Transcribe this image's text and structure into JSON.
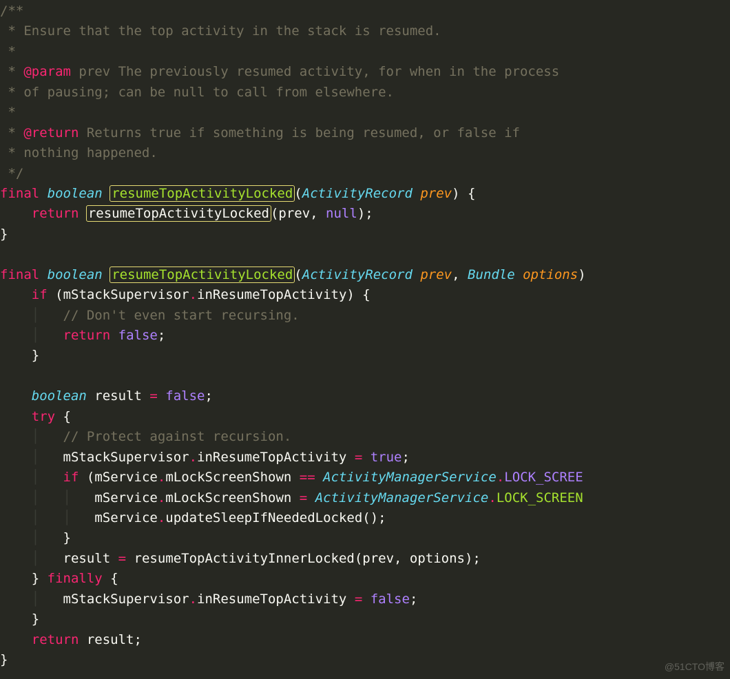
{
  "doc": {
    "start": "/**",
    "l1": " * Ensure that the top activity in the stack is resumed.",
    "l2": " *",
    "l3_a": " * ",
    "l3_tag": "@param",
    "l3_b": " prev The previously resumed activity, for when in the process",
    "l4": " * of pausing; can be null to call from elsewhere.",
    "l5": " *",
    "l6_a": " * ",
    "l6_tag": "@return",
    "l6_b": " Returns true if something is being resumed, or false if",
    "l7": " * nothing happened.",
    "end": " */"
  },
  "kw": {
    "final": "final",
    "boolean": "boolean",
    "return": "return",
    "if": "if",
    "try": "try",
    "finally": "finally"
  },
  "fn": {
    "name": "resumeTopActivityLocked",
    "inner": "resumeTopActivityInnerLocked",
    "update": "updateSleepIfNeededLocked"
  },
  "types": {
    "ActivityRecord": "ActivityRecord",
    "Bundle": "Bundle",
    "AMS": "ActivityManagerService"
  },
  "params": {
    "prev": "prev",
    "options": "options"
  },
  "vals": {
    "null": "null",
    "true": "true",
    "false": "false"
  },
  "ident": {
    "mStackSupervisor": "mStackSupervisor",
    "inResumeTopActivity": "inResumeTopActivity",
    "mService": "mService",
    "mLockScreenShown": "mLockScreenShown",
    "result": "result",
    "prev": "prev",
    "options": "options"
  },
  "consts": {
    "LOCK_SCREEN_1": "LOCK_SCREE",
    "LOCK_SCREEN_2": "LOCK_SCREEN"
  },
  "comments": {
    "dont_recurse": "// Don't even start recursing.",
    "protect": "// Protect against recursion."
  },
  "watermark": "@51CTO博客"
}
